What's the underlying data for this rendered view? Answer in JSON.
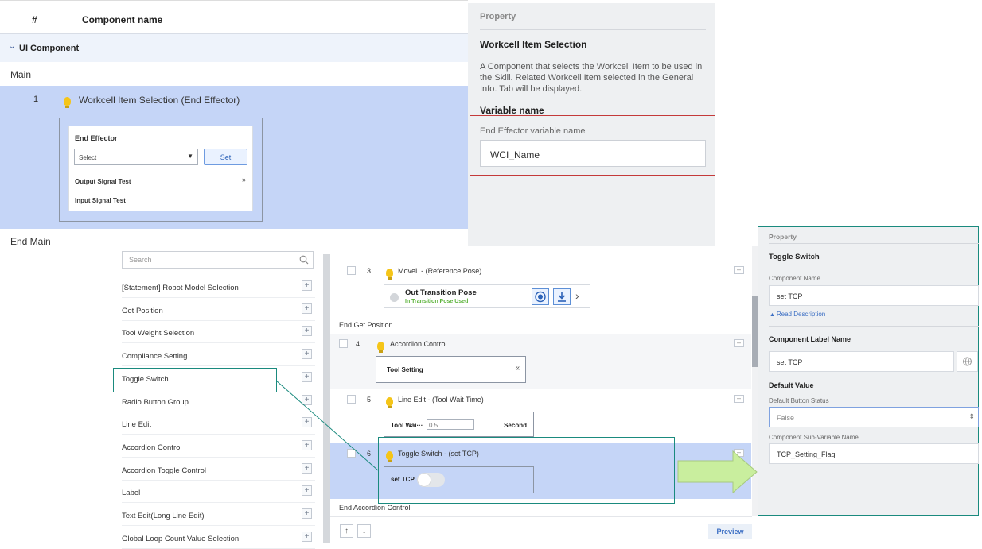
{
  "table": {
    "col_num": "#",
    "col_name": "Component name",
    "section": "UI Component",
    "main": "Main",
    "row_num": "1",
    "row_label": "Workcell Item Selection (End Effector)",
    "end_main": "End Main",
    "preview": {
      "title": "End Effector",
      "select_value": "Select",
      "set_label": "Set",
      "output_signal": "Output Signal Test",
      "input_signal": "Input Signal Test"
    }
  },
  "property_top": {
    "header": "Property",
    "title": "Workcell Item Selection",
    "description": "A Component that selects the Workcell Item to be used in the Skill. Related Workcell Item selected in the General Info. Tab will be displayed.",
    "var_title": "Variable name",
    "field_label": "End Effector variable name",
    "field_value": "WCI_Name"
  },
  "component_list": {
    "search_placeholder": "Search",
    "items": [
      "[Statement] Robot Model Selection",
      "Get Position",
      "Tool Weight Selection",
      "Compliance Setting",
      "Toggle Switch",
      "Radio Button Group",
      "Line Edit",
      "Accordion Control",
      "Accordion Toggle Control",
      "Label",
      "Text Edit(Long Line Edit)",
      "Global Loop Count Value Selection"
    ]
  },
  "editor": {
    "row3_num": "3",
    "row3_label": "MoveL - (Reference Pose)",
    "out_pose": "Out Transition Pose",
    "in_pose": "In Transition Pose Used",
    "end_get_position": "End Get Position",
    "row4_num": "4",
    "row4_label": "Accordion Control",
    "tool_setting": "Tool Setting",
    "row5_num": "5",
    "row5_label": "Line Edit - (Tool Wait Time)",
    "tool_wait": "Tool Wai···",
    "tool_wait_value": "0.5",
    "second": "Second",
    "row6_num": "6",
    "row6_label": "Toggle Switch - (set TCP)",
    "set_tcp": "set TCP",
    "end_accordion": "End Accordion Control",
    "preview": "Preview",
    "up_arrow": "↑",
    "down_arrow": "↓"
  },
  "property_bottom": {
    "header": "Property",
    "title": "Toggle Switch",
    "component_name_label": "Component Name",
    "component_name_value": "set TCP",
    "read_description": "Read Description",
    "label_name_title": "Component Label Name",
    "label_name_value": "set TCP",
    "default_value_title": "Default Value",
    "default_button_label": "Default Button Status",
    "default_button_value": "False",
    "subvar_label": "Component Sub-Variable Name",
    "subvar_value": "TCP_Setting_Flag"
  },
  "colors": {
    "selection": "#c5d5f7",
    "highlight_teal": "#1a8a7e",
    "highlight_red": "#c43a3a",
    "arrow_green": "#c9ee9e"
  }
}
